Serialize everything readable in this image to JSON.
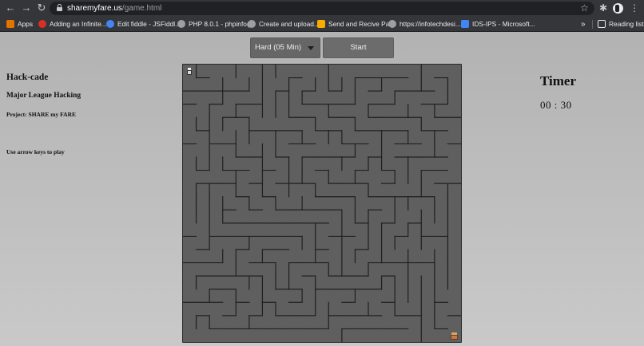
{
  "browser": {
    "url_host": "sharemyfare.us",
    "url_path": "/game.html",
    "bookmarks": [
      {
        "label": "Apps",
        "color": "#e37400"
      },
      {
        "label": "Adding an Infinite...",
        "color": "#d93025"
      },
      {
        "label": "Edit fiddle - JSFiddl...",
        "color": "#4285f4"
      },
      {
        "label": "PHP 8.0.1 - phpinfo()",
        "color": "#9aa0a6"
      },
      {
        "label": "Create and upload...",
        "color": "#9aa0a6"
      },
      {
        "label": "Send and Recive Pa...",
        "color": "#f9ab00"
      },
      {
        "label": "https://infotechdesi...",
        "color": "#9aa0a6"
      },
      {
        "label": "IDS-IPS - Microsoft...",
        "color": "#4285f4"
      }
    ],
    "more_label": "»",
    "reading_list": "Reading list"
  },
  "controls": {
    "difficulty": "Hard (05 Min)",
    "start": "Start"
  },
  "sidebar": {
    "title": "Hack-cade",
    "subtitle": "Major League Hacking",
    "project": "Project: SHARE my FARE",
    "hint": "Use arrow keys to play"
  },
  "timer": {
    "title": "Timer",
    "value": "00 : 30"
  },
  "maze": {
    "rows": 21,
    "cols": 21,
    "wall_color": "#202020",
    "floor_color": "#5f5f5f"
  }
}
